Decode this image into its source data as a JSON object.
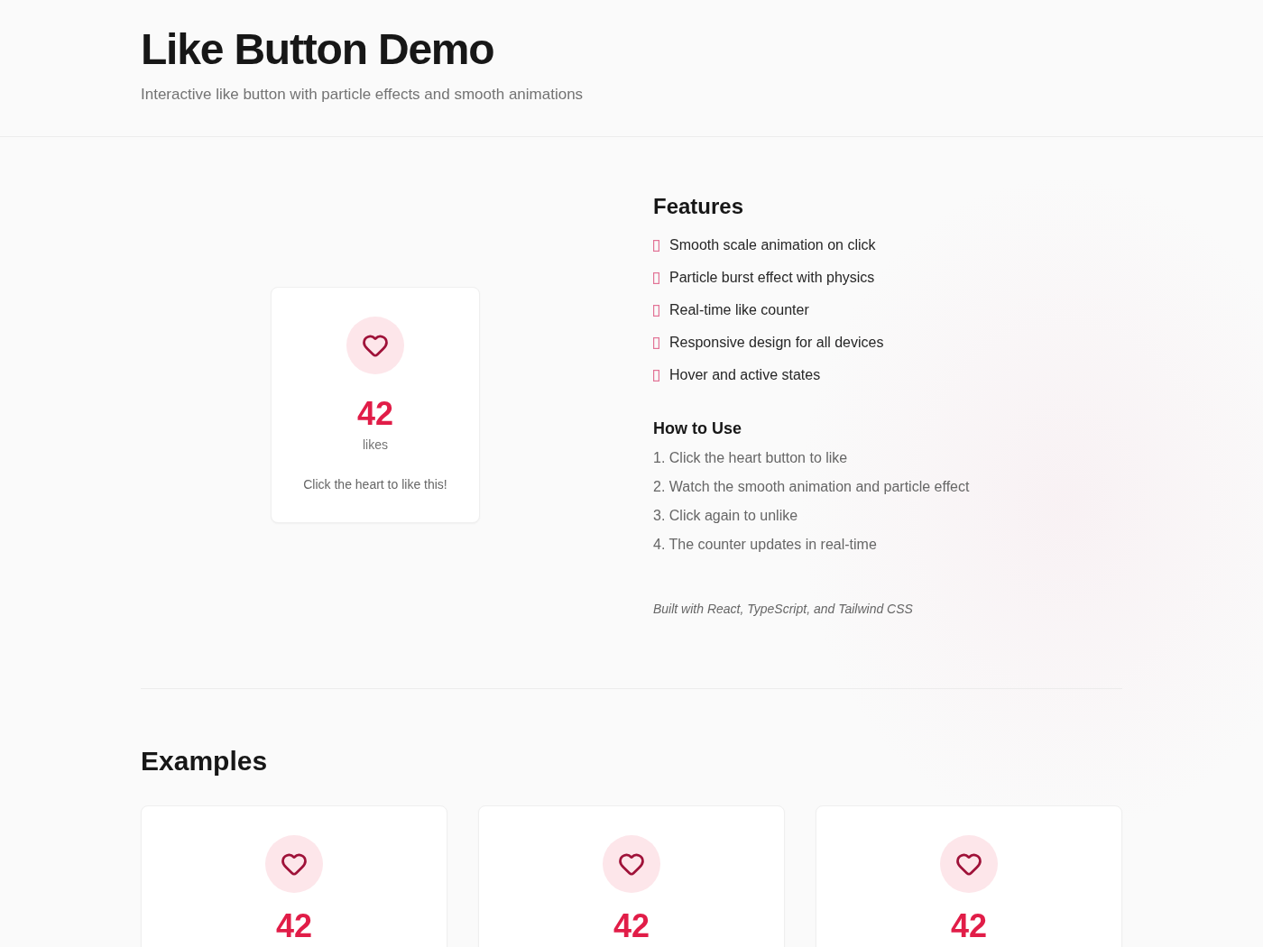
{
  "header": {
    "title": "Like Button Demo",
    "subtitle": "Interactive like button with particle effects and smooth animations"
  },
  "demo_card": {
    "liked": false,
    "count": "42",
    "unit": "likes",
    "hint": "Click the heart to like this!"
  },
  "features": {
    "title": "Features",
    "items": [
      "Smooth scale animation on click",
      "Particle burst effect with physics",
      "Real-time like counter",
      "Responsive design for all devices",
      "Hover and active states"
    ]
  },
  "how_to_use": {
    "title": "How to Use",
    "steps": [
      "1. Click the heart button to like",
      "2. Watch the smooth animation and particle effect",
      "3. Click again to unlike",
      "4. The counter updates in real-time"
    ]
  },
  "footnote": "Built with React, TypeScript, and Tailwind CSS",
  "examples": {
    "title": "Examples",
    "cards": [
      {
        "liked": false,
        "count": "42"
      },
      {
        "liked": false,
        "count": "42"
      },
      {
        "liked": false,
        "count": "42"
      }
    ]
  }
}
